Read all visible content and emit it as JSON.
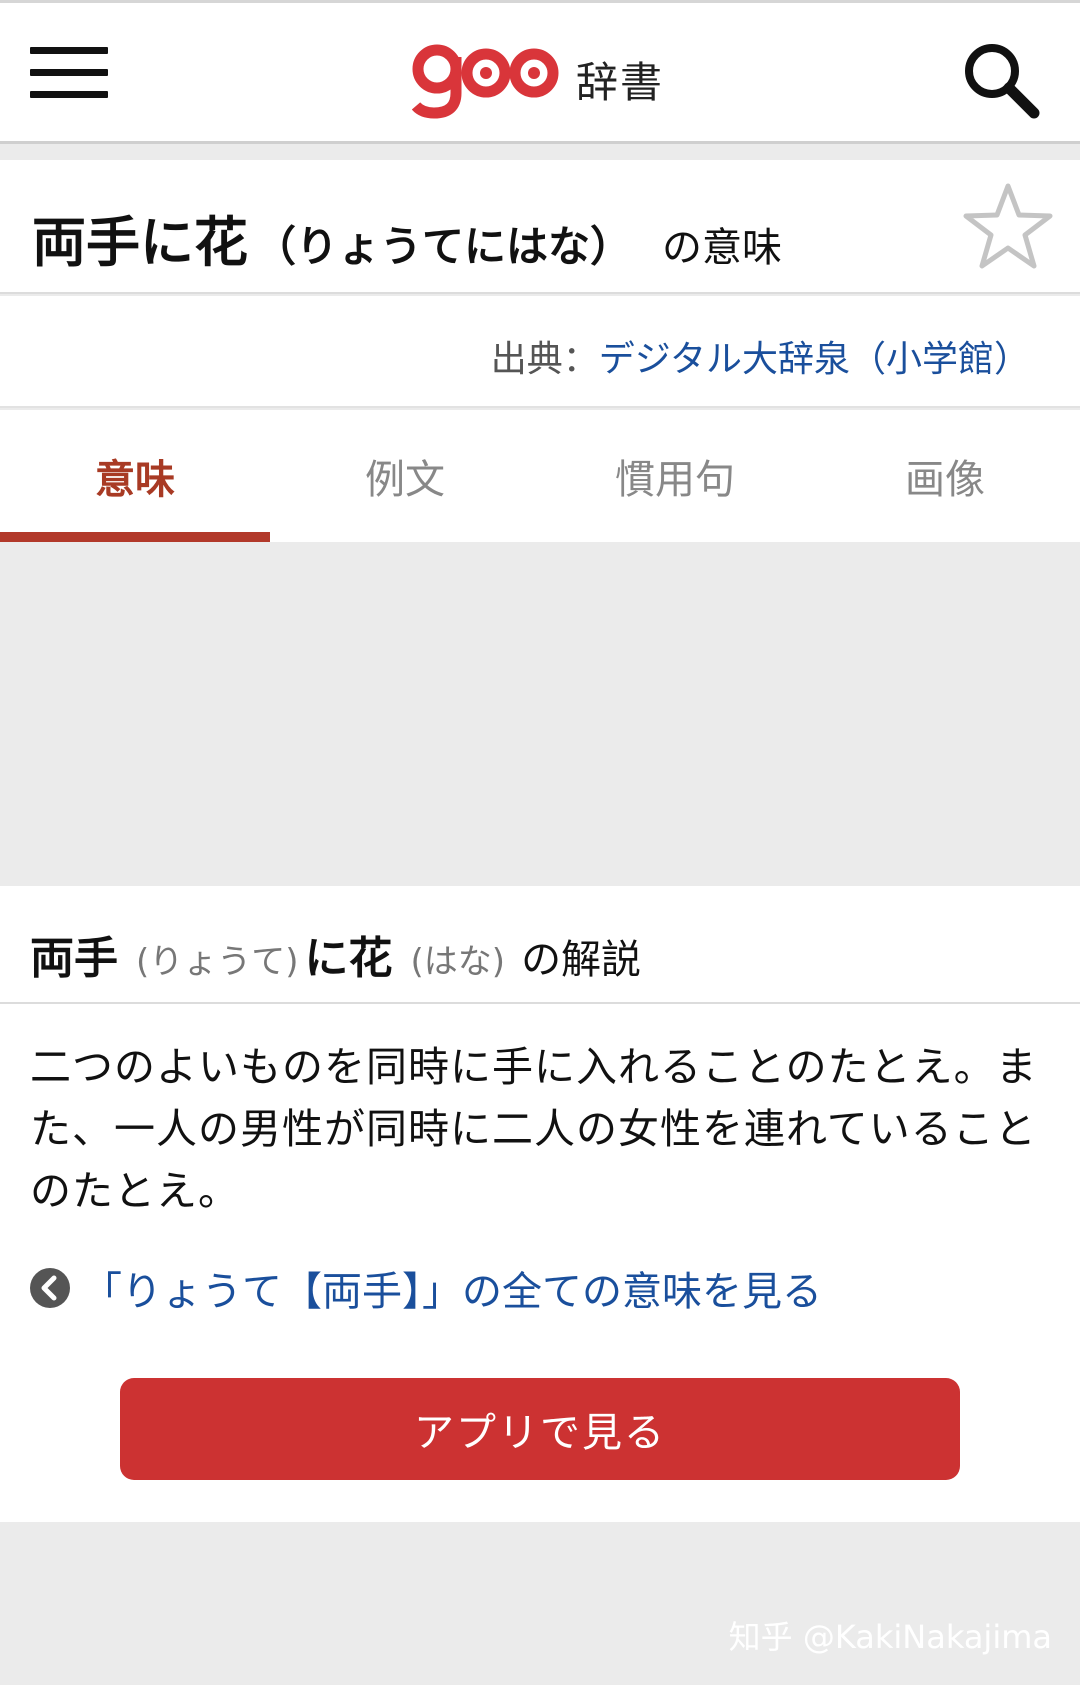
{
  "header": {
    "logo_text": "goo",
    "logo_label": "辞書",
    "logo_color": "#d9353a"
  },
  "title": {
    "word": "両手に花",
    "reading": "（りょうてにはな）",
    "suffix": "の意味"
  },
  "source": {
    "label": "出典：",
    "link_text": "デジタル大辞泉（小学館）"
  },
  "tabs": [
    {
      "label": "意味",
      "active": true
    },
    {
      "label": "例文",
      "active": false
    },
    {
      "label": "慣用句",
      "active": false
    },
    {
      "label": "画像",
      "active": false
    }
  ],
  "explanation": {
    "heading_word1": "両手",
    "heading_reading1": "(りょうて)",
    "heading_word2": "に花",
    "heading_reading2": "(はな)",
    "heading_suffix": "の解説",
    "body": "二つのよいものを同時に手に入れることのたとえ。また、一人の男性が同時に二人の女性を連れていることのたとえ。",
    "more_link": "「りょうて【両手】」の全ての意味を見る",
    "app_button": "アプリで見る"
  },
  "watermark": "知乎 @KakiNakajima",
  "colors": {
    "accent": "#b2392a",
    "link": "#1a4f9c",
    "button": "#cc3232"
  },
  "icons": [
    "menu-icon",
    "search-icon",
    "star-icon",
    "chevron-left-icon"
  ]
}
